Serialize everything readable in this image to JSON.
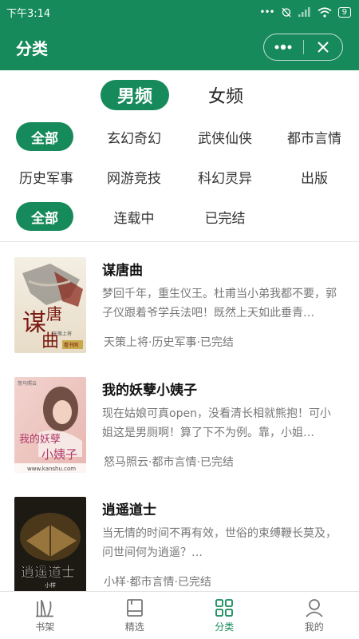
{
  "status_bar": {
    "time": "下午3:14",
    "battery": "9"
  },
  "header": {
    "title": "分类"
  },
  "gender_tabs": [
    {
      "label": "男频",
      "active": true
    },
    {
      "label": "女频",
      "active": false
    }
  ],
  "categories": [
    "全部",
    "玄幻奇幻",
    "武侠仙侠",
    "都市言情",
    "历史军事",
    "网游竞技",
    "科幻灵异",
    "出版"
  ],
  "status_filters": [
    "全部",
    "连载中",
    "已完结"
  ],
  "books": [
    {
      "title": "谋唐曲",
      "desc": "梦回千年，重生仪王。杜甫当小弟我都不要，郭子仪跟着爷学兵法吧！既然上天如此垂青…",
      "meta": "天策上将·历史军事·已完结",
      "cover_text": "谋唐曲",
      "cover_sub": "天策上将",
      "cover_badge": "看书网"
    },
    {
      "title": "我的妖孽小姨子",
      "desc": "现在姑娘可真open，没看清长相就熊抱！可小姐这是男厕啊！算了下不为例。靠，小姐…",
      "meta": "怒马照云·都市言情·已完结",
      "cover_text": "我的妖孽小姨子",
      "cover_sub": "怒马照云",
      "cover_footer": "www.kanshu.com"
    },
    {
      "title": "逍遥道士",
      "desc": "当无情的时间不再有效，世俗的束缚鞭长莫及，问世间何为逍遥？…",
      "meta": "小样·都市言情·已完结",
      "cover_text": "逍遥道士",
      "cover_sub": "小样"
    }
  ],
  "bottom_nav": [
    {
      "label": "书架",
      "icon": "bookshelf-icon",
      "active": false
    },
    {
      "label": "精选",
      "icon": "book-icon",
      "active": false
    },
    {
      "label": "分类",
      "icon": "grid-icon",
      "active": true
    },
    {
      "label": "我的",
      "icon": "user-icon",
      "active": false
    }
  ],
  "colors": {
    "accent": "#168a5a"
  }
}
